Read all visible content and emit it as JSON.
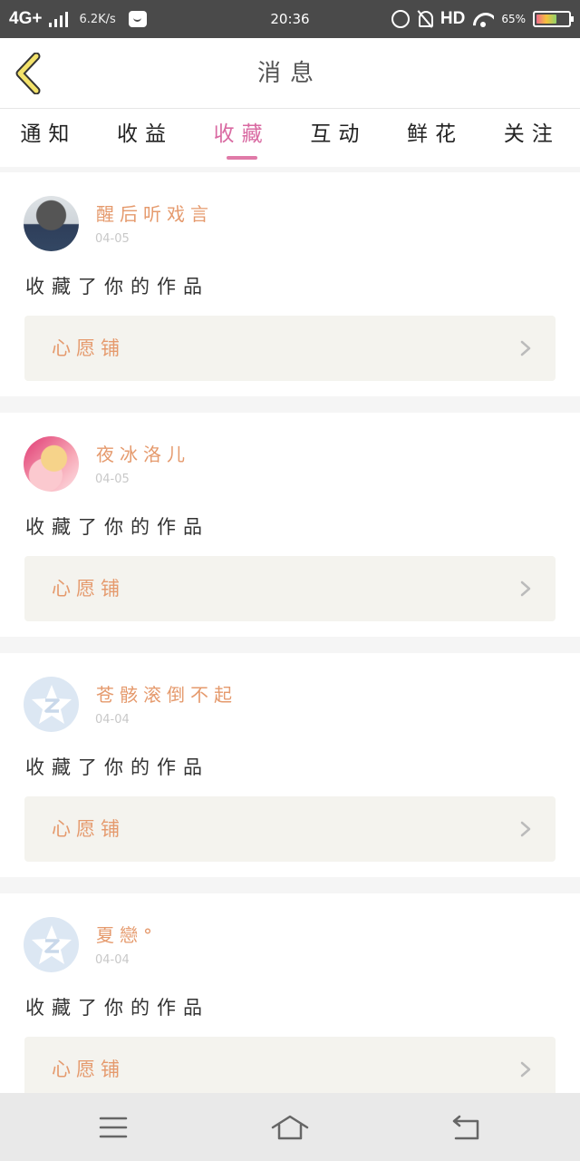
{
  "status_bar": {
    "network": "4G+",
    "speed": "6.2K/s",
    "time": "20:36",
    "hd": "HD",
    "battery": "65%"
  },
  "header": {
    "title": "消息"
  },
  "tabs": [
    {
      "label": "通知"
    },
    {
      "label": "收益"
    },
    {
      "label": "收藏",
      "active": true
    },
    {
      "label": "互动"
    },
    {
      "label": "鲜花"
    },
    {
      "label": "关注"
    }
  ],
  "messages": [
    {
      "name": "醒后听戏言",
      "date": "04-05",
      "action": "收藏了你的作品",
      "work": "心愿铺",
      "avatar": "photo-avatar"
    },
    {
      "name": "夜冰洛儿",
      "date": "04-05",
      "action": "收藏了你的作品",
      "work": "心愿铺",
      "avatar": "photo-avatar"
    },
    {
      "name": "苍骸滚倒不起",
      "date": "04-04",
      "action": "收藏了你的作品",
      "work": "心愿铺",
      "avatar": "default-qzone-avatar"
    },
    {
      "name": "夏戀°",
      "date": "04-04",
      "action": "收藏了你的作品",
      "work": "心愿铺",
      "avatar": "default-qzone-avatar"
    }
  ],
  "colors": {
    "accent": "#d96aa2",
    "name": "#e59a6d",
    "back_arrow": "#f3e26a"
  },
  "icons": {
    "back": "chevron-left-icon",
    "menu": "menu-icon",
    "home": "home-icon",
    "return": "back-icon"
  }
}
